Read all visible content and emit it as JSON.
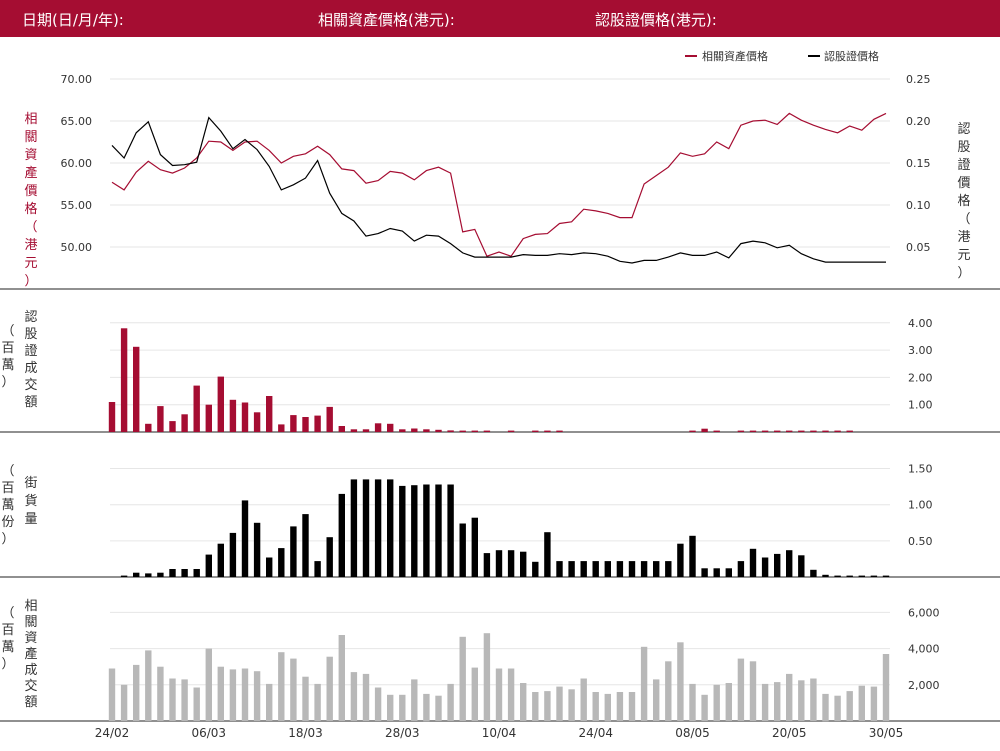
{
  "header": {
    "date_label": "日期(日/月/年):",
    "underlying_label": "相關資產價格(港元):",
    "warrant_label": "認股證價格(港元):"
  },
  "colors": {
    "header_bg": "#a50d32",
    "underlying": "#a50d32",
    "warrant": "#000000",
    "turnover_bar": "#a50d32",
    "outstanding_bar": "#000000",
    "underlying_turnover_bar": "#b8b8b8",
    "grid": "#e6e6e6"
  },
  "chart_data": [
    {
      "type": "line",
      "legend_position": "top-right",
      "grid": true,
      "left_axis_label": "相關資產價格（港元）",
      "right_axis_label": "認股證價格（港元）",
      "left_ticks": [
        "50.00",
        "55.00",
        "60.00",
        "65.00",
        "70.00"
      ],
      "right_ticks": [
        "0.05",
        "0.10",
        "0.15",
        "0.20",
        "0.25"
      ],
      "left_ylim": [
        46.0,
        70.0
      ],
      "right_ylim": [
        0.0,
        0.25
      ],
      "series": [
        {
          "name": "相關資產價格",
          "axis": "left",
          "values": [
            57.7,
            56.8,
            58.9,
            60.2,
            59.2,
            58.8,
            59.4,
            60.6,
            62.6,
            62.5,
            61.5,
            62.5,
            62.6,
            61.5,
            60.0,
            60.8,
            61.1,
            62.0,
            61.0,
            59.3,
            59.1,
            57.6,
            57.9,
            59.0,
            58.8,
            58.0,
            59.1,
            59.5,
            58.8,
            51.8,
            52.1,
            48.9,
            49.4,
            48.9,
            51.0,
            51.5,
            51.6,
            52.8,
            53.0,
            54.5,
            54.3,
            54.0,
            53.5,
            53.5,
            57.5,
            58.5,
            59.5,
            61.2,
            60.8,
            61.1,
            62.5,
            61.7,
            64.5,
            65.0,
            65.1,
            64.6,
            65.9,
            65.1,
            64.5,
            64.0,
            63.6,
            64.4,
            63.9,
            65.2,
            65.9
          ]
        },
        {
          "name": "認股證價格",
          "axis": "left",
          "values": [
            0.171,
            0.156,
            0.186,
            0.199,
            0.16,
            0.147,
            0.148,
            0.151,
            0.204,
            0.188,
            0.167,
            0.178,
            0.166,
            0.146,
            0.118,
            0.124,
            0.132,
            0.153,
            0.114,
            0.09,
            0.081,
            0.063,
            0.066,
            0.072,
            0.069,
            0.057,
            0.064,
            0.063,
            0.054,
            0.043,
            0.038,
            0.038,
            0.038,
            0.038,
            0.041,
            0.04,
            0.04,
            0.042,
            0.041,
            0.043,
            0.042,
            0.039,
            0.033,
            0.031,
            0.034,
            0.034,
            0.038,
            0.043,
            0.04,
            0.04,
            0.044,
            0.037,
            0.054,
            0.057,
            0.055,
            0.049,
            0.052,
            0.042,
            0.036,
            0.032,
            0.032,
            0.032,
            0.032,
            0.032,
            0.032
          ]
        }
      ]
    },
    {
      "type": "bar",
      "ylabel": "認股證成交額（百萬）",
      "ticks": [
        "1.00",
        "2.00",
        "3.00",
        "4.00"
      ],
      "ylim": [
        0,
        4.5
      ],
      "values": [
        1.1,
        3.8,
        3.12,
        0.3,
        0.95,
        0.4,
        0.65,
        1.7,
        1.0,
        2.03,
        1.18,
        1.08,
        0.72,
        1.32,
        0.28,
        0.62,
        0.55,
        0.6,
        0.92,
        0.22,
        0.1,
        0.1,
        0.32,
        0.3,
        0.1,
        0.13,
        0.1,
        0.08,
        0.06,
        0.05,
        0.05,
        0.05,
        0,
        0.05,
        0,
        0.05,
        0.05,
        0.05,
        0,
        0,
        0,
        0,
        0,
        0,
        0,
        0,
        0,
        0,
        0.05,
        0.12,
        0.05,
        0,
        0.05,
        0.05,
        0.05,
        0.05,
        0.05,
        0.05,
        0.05,
        0.05,
        0.05,
        0.05,
        0,
        0,
        0
      ]
    },
    {
      "type": "bar",
      "ylabel": "街貨量（百萬份）",
      "ticks": [
        "0.50",
        "1.00",
        "1.50"
      ],
      "ylim": [
        0,
        1.62
      ],
      "values": [
        0,
        0.02,
        0.06,
        0.05,
        0.06,
        0.11,
        0.11,
        0.11,
        0.31,
        0.46,
        0.61,
        1.06,
        0.75,
        0.27,
        0.4,
        0.7,
        0.87,
        0.22,
        0.55,
        1.15,
        1.35,
        1.35,
        1.35,
        1.35,
        1.26,
        1.27,
        1.28,
        1.28,
        1.28,
        0.74,
        0.82,
        0.33,
        0.37,
        0.37,
        0.35,
        0.21,
        0.62,
        0.22,
        0.22,
        0.22,
        0.22,
        0.22,
        0.22,
        0.22,
        0.22,
        0.22,
        0.22,
        0.46,
        0.57,
        0.12,
        0.12,
        0.12,
        0.22,
        0.39,
        0.27,
        0.32,
        0.37,
        0.3,
        0.1,
        0.03,
        0.02,
        0.02,
        0.02,
        0.02,
        0.02
      ]
    },
    {
      "type": "bar",
      "ylabel": "相關資產成交額（百萬）",
      "ticks": [
        "2,000",
        "4,000",
        "6,000"
      ],
      "ylim": [
        0,
        6500
      ],
      "x_ticks": [
        "24/02",
        "06/03",
        "18/03",
        "28/03",
        "10/04",
        "24/04",
        "08/05",
        "20/05",
        "30/05"
      ],
      "values": [
        2900,
        2000,
        3100,
        3900,
        3000,
        2350,
        2300,
        1850,
        4000,
        3000,
        2850,
        2900,
        2750,
        2050,
        3800,
        3450,
        2450,
        2050,
        3550,
        4750,
        2700,
        2600,
        1850,
        1450,
        1450,
        2300,
        1500,
        1400,
        2050,
        4650,
        2950,
        4850,
        2900,
        2900,
        2100,
        1600,
        1650,
        1900,
        1750,
        2350,
        1600,
        1500,
        1600,
        1600,
        4100,
        2300,
        3300,
        4350,
        2050,
        1450,
        2000,
        2100,
        3450,
        3300,
        2050,
        2150,
        2600,
        2250,
        2350,
        1500,
        1400,
        1650,
        1950,
        1900,
        3700
      ]
    }
  ]
}
